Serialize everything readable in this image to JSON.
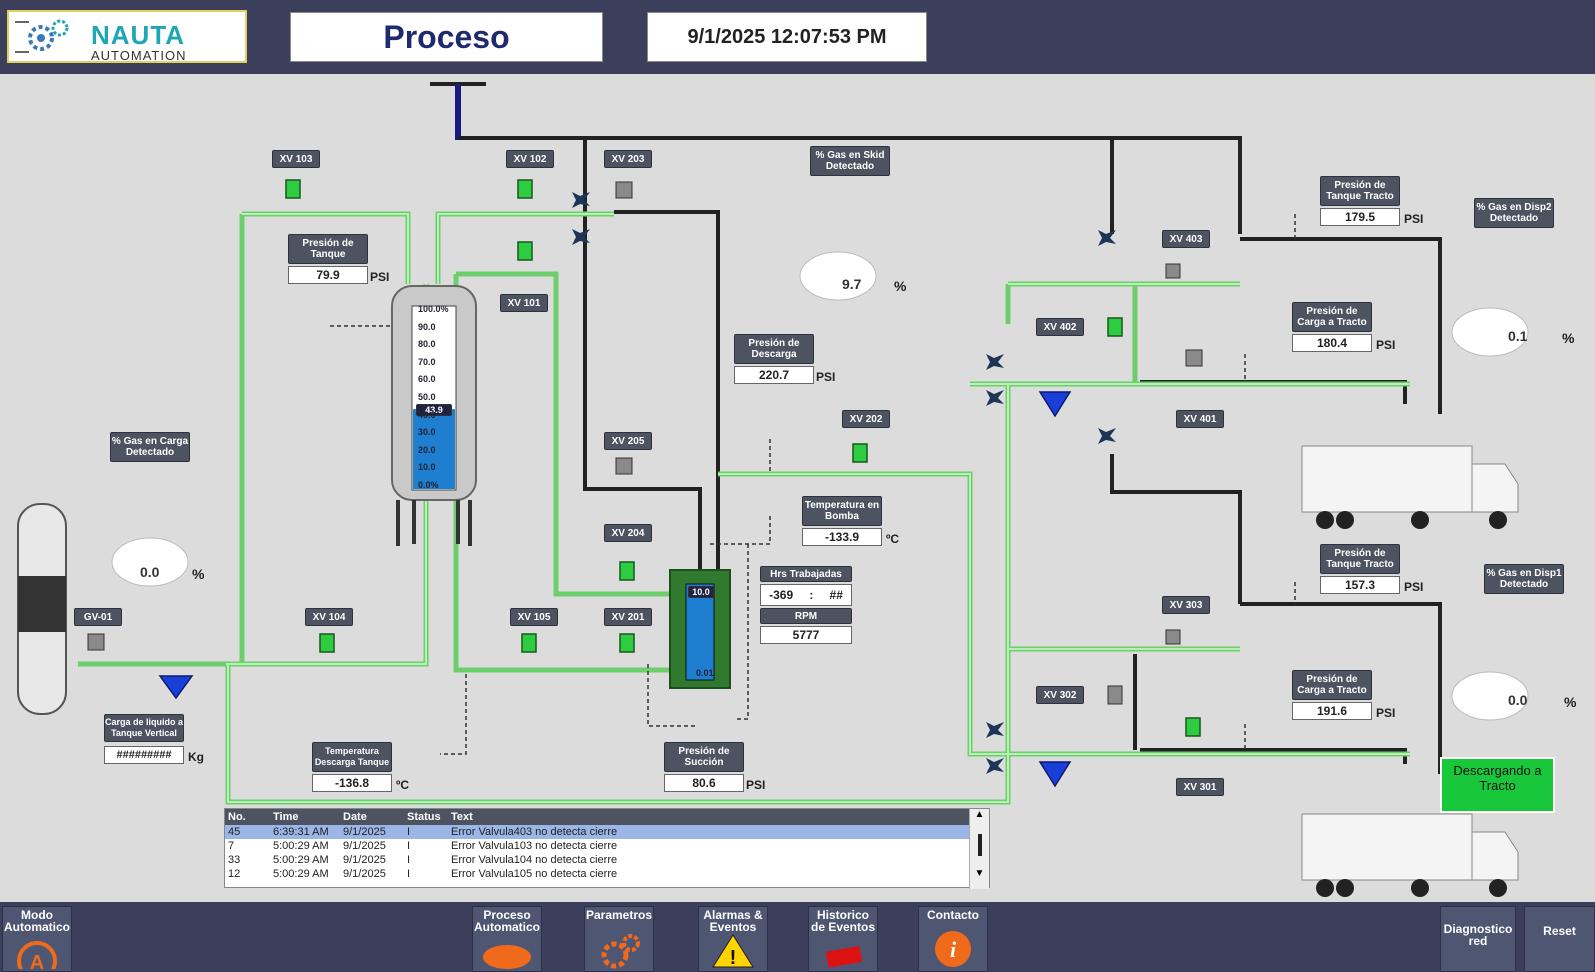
{
  "header": {
    "logo_name": "NAUTA",
    "logo_sub": "AUTOMATION",
    "title": "Proceso",
    "datetime": "9/1/2025 12:07:53 PM"
  },
  "tags": {
    "xv103": "XV 103",
    "xv102": "XV 102",
    "xv203": "XV 203",
    "xv101": "XV 101",
    "xv205": "XV 205",
    "xv204": "XV 204",
    "xv201": "XV 201",
    "xv202": "XV 202",
    "xv104": "XV 104",
    "xv105": "XV 105",
    "gv01": "GV-01",
    "xv403": "XV 403",
    "xv402": "XV 402",
    "xv401": "XV 401",
    "xv303": "XV 303",
    "xv302": "XV 302",
    "xv301": "XV 301"
  },
  "readings": {
    "presion_tanque_label": "Presión de Tanque",
    "presion_tanque": "79.9",
    "presion_descarga_label": "Presión de Descarga",
    "presion_descarga": "220.7",
    "gas_skid_label": "% Gas en Skid Detectado",
    "gas_skid": "9.7",
    "gas_carga_label": "% Gas en Carga Detectado",
    "gas_carga": "0.0",
    "temp_bomba_label": "Temperatura en Bomba",
    "temp_bomba": "-133.9",
    "hrs_label": "Hrs Trabajadas",
    "hrs_h": "-369",
    "hrs_sep": ":",
    "hrs_m": "##",
    "rpm_label": "RPM",
    "rpm": "5777",
    "temp_descarga_label": "Temperatura Descarga Tanque",
    "temp_descarga": "-136.8",
    "presion_succion_label": "Presión de Succión",
    "presion_succion": "80.6",
    "carga_liquido_label": "Carga de liquido a Tanque Vertical",
    "carga_liquido": "#########",
    "presion_tanque_tracto1_label": "Presión de Tanque Tracto",
    "presion_tanque_tracto1": "179.5",
    "presion_carga_tracto1_label": "Presión de Carga a Tracto",
    "presion_carga_tracto1": "180.4",
    "presion_tanque_tracto2_label": "Presión de Tanque Tracto",
    "presion_tanque_tracto2": "157.3",
    "presion_carga_tracto2_label": "Presión de Carga a Tracto",
    "presion_carga_tracto2": "191.6",
    "gas_disp2_label": "% Gas en Disp2 Detectado",
    "gas_disp2": "0.1",
    "gas_disp1_label": "% Gas en Disp1 Detectado",
    "gas_disp1": "0.0",
    "tank_level": "43.9",
    "pump_top": "10.0",
    "pump_bottom": "0.01"
  },
  "units": {
    "psi": "PSI",
    "pct": "%",
    "degc": "ºC",
    "kg": "Kg"
  },
  "tank_scale": [
    "100.0%",
    "90.0",
    "80.0",
    "70.0",
    "60.0",
    "50.0",
    "40.0",
    "30.0",
    "20.0",
    "10.0",
    "0.0%"
  ],
  "tank_fill_pct": 43.9,
  "status_box": "Descargando a Tracto",
  "alarms": {
    "headers": [
      "No.",
      "Time",
      "Date",
      "Status",
      "Text"
    ],
    "rows": [
      [
        "45",
        "6:39:31 AM",
        "9/1/2025",
        "I",
        "Error Valvula403 no detecta cierre"
      ],
      [
        "7",
        "5:00:29 AM",
        "9/1/2025",
        "I",
        "Error Valvula103 no detecta cierre"
      ],
      [
        "33",
        "5:00:29 AM",
        "9/1/2025",
        "I",
        "Error Valvula104 no detecta cierre"
      ],
      [
        "12",
        "5:00:29 AM",
        "9/1/2025",
        "I",
        "Error Valvula105 no detecta cierre"
      ]
    ]
  },
  "nav": {
    "modo": "Modo Automatico",
    "proceso": "Proceso Automatico",
    "parametros": "Parametros",
    "alarmas": "Alarmas & Eventos",
    "historico": "Historico de Eventos",
    "contacto": "Contacto",
    "diagnostico": "Diagnostico red",
    "reset": "Reset"
  },
  "colors": {
    "accent": "#3b3f5c",
    "pipe_green": "#7fe37f",
    "status_green": "#19c83a",
    "tank_blue": "#1e7fd0"
  }
}
